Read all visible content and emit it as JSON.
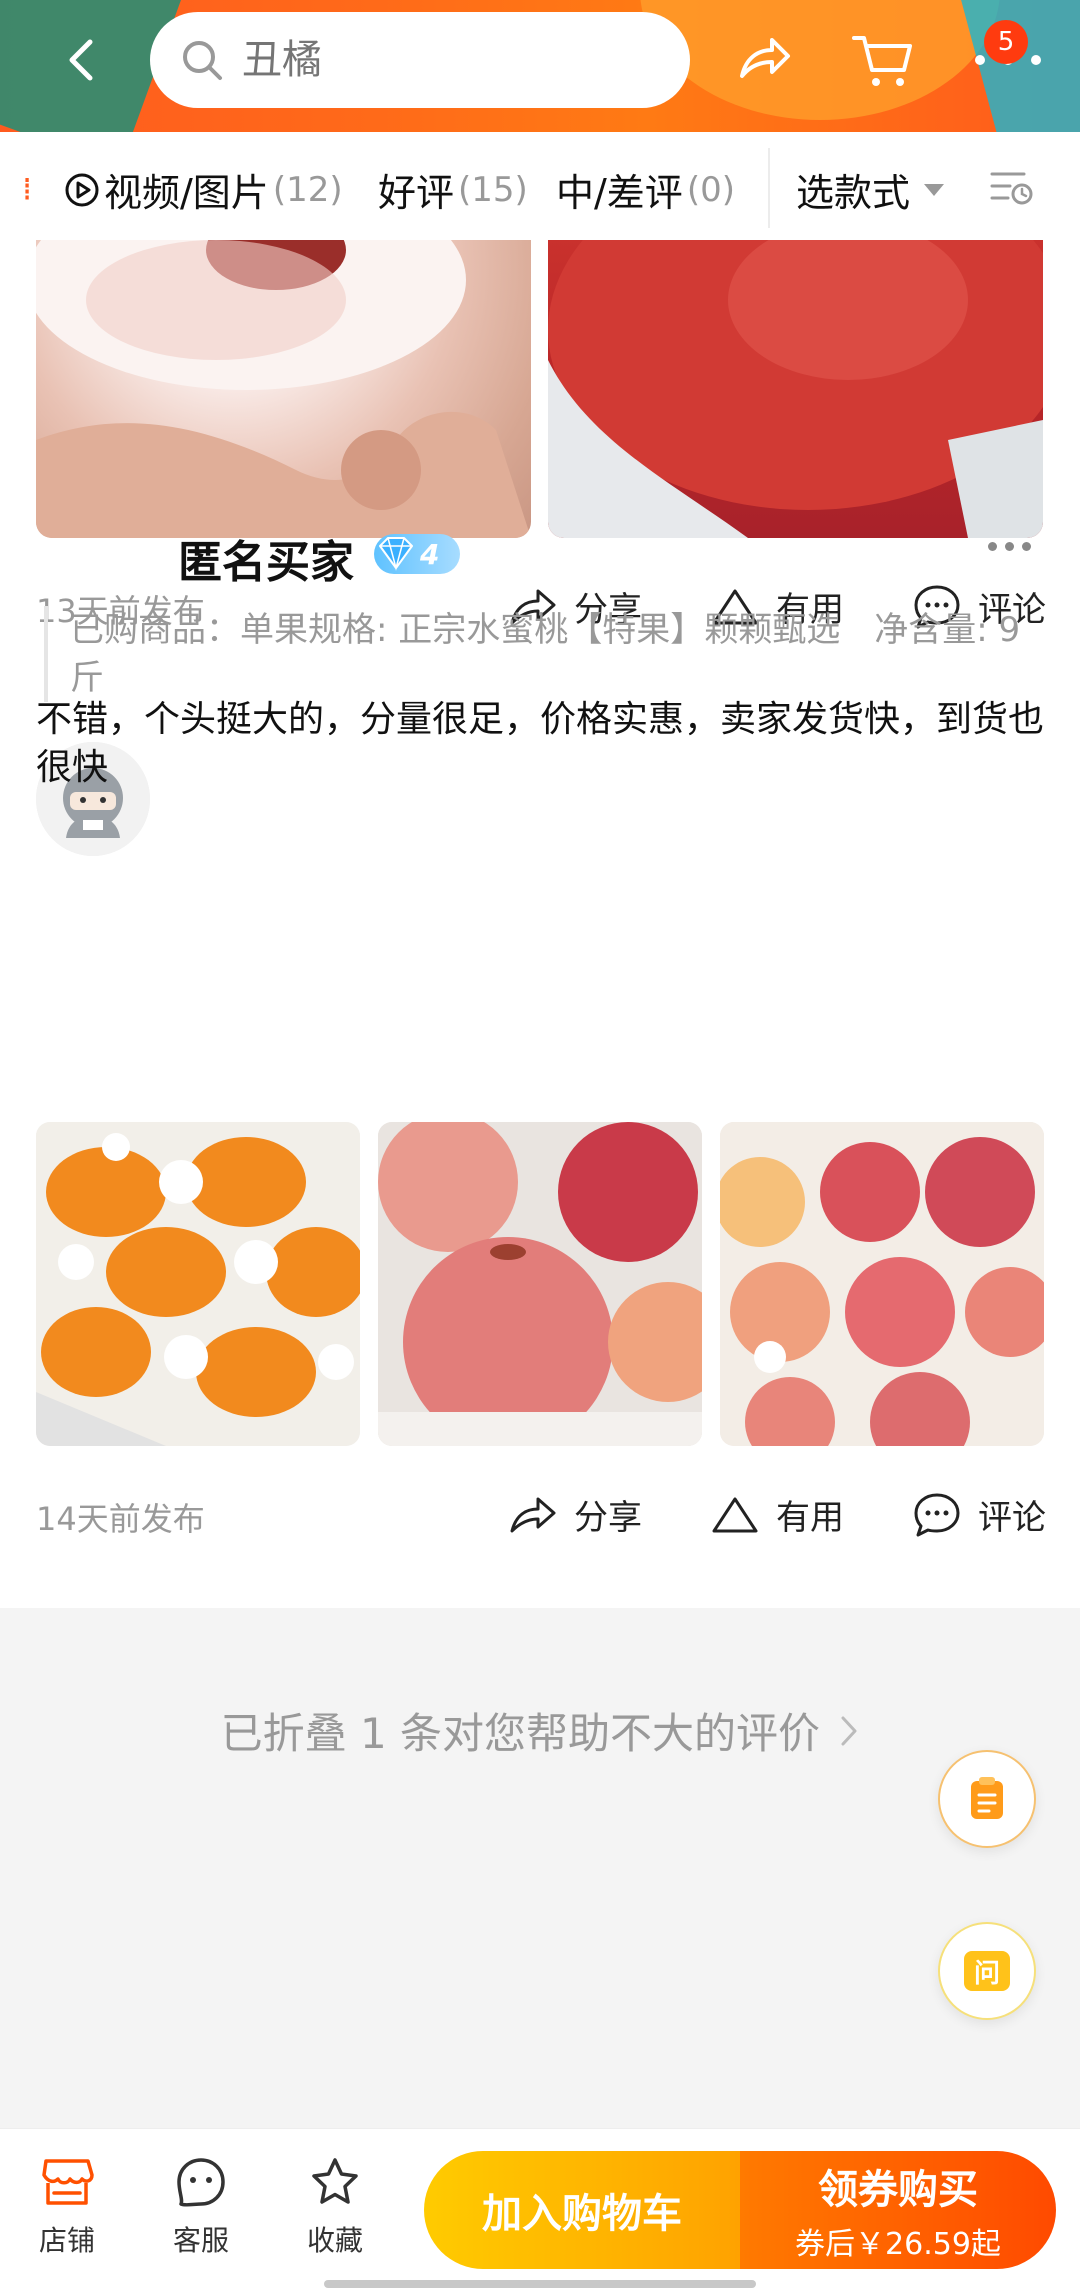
{
  "header": {
    "search_placeholder": "丑橘",
    "cart_badge": "5"
  },
  "filters": {
    "tabs": [
      {
        "label": "视频/图片",
        "count": "(12)"
      },
      {
        "label": "好评",
        "count": "(15)"
      },
      {
        "label": "中/差评",
        "count": "(0)"
      }
    ],
    "select_label": "选款式"
  },
  "reviews": [
    {
      "posted": "13天前发布",
      "actions": {
        "share": "分享",
        "useful": "有用",
        "comment": "评论"
      }
    },
    {
      "user": "匿名买家",
      "level": "4",
      "purchased": "已购商品：单果规格: 正宗水蜜桃【特果】颗颗甄选　净含量: 9斤",
      "text": "不错，个头挺大的，分量很足，价格实惠，卖家发货快，到货也很快",
      "posted": "14天前发布",
      "actions": {
        "share": "分享",
        "useful": "有用",
        "comment": "评论"
      }
    }
  ],
  "folded_text": "已折叠 1 条对您帮助不大的评价",
  "float_buttons": {
    "ask": "问"
  },
  "bottom": {
    "shop": "店铺",
    "service": "客服",
    "favorite": "收藏",
    "add_cart": "加入购物车",
    "buy": "领券购买",
    "buy_sub": "券后￥26.59起"
  },
  "colors": {
    "accent": "#ff5b1f",
    "cart_btn": "#ffb300",
    "buy_btn": "#ff5a00"
  }
}
